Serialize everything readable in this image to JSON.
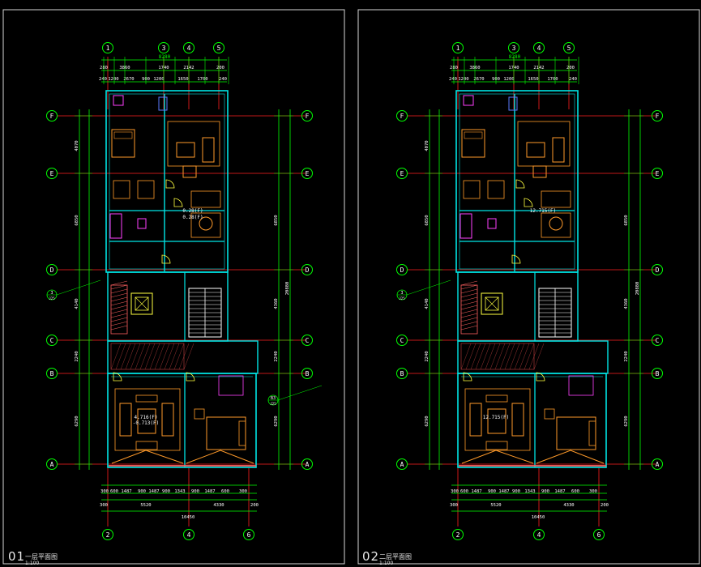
{
  "sheets": [
    {
      "number": "01",
      "title": "一层平面图",
      "scale": "1:100",
      "top_grid_labels": [
        "1",
        "3",
        "4",
        "5"
      ],
      "bottom_grid_labels": [
        "2",
        "4",
        "6"
      ],
      "row_labels": [
        "F",
        "E",
        "D",
        "C",
        "B",
        "A"
      ],
      "top_total": "8280",
      "top_dims_1": [
        "280",
        "3860",
        "1740",
        "2142",
        "200"
      ],
      "top_dims_2": [
        "240",
        "1200",
        "2670",
        "900",
        "1200",
        "1650",
        "1700",
        "240"
      ],
      "bottom_dims_1": [
        "300",
        "600",
        "1487",
        "900",
        "1487",
        "900",
        "1343",
        "900",
        "1487",
        "600",
        "300"
      ],
      "bottom_dims_2": [
        "300",
        "5520",
        "4330",
        "200"
      ],
      "bottom_total": "10450",
      "left_dims_outer": [
        "6850",
        "4140",
        "2240"
      ],
      "left_dims_inner": [
        "4070",
        "6290"
      ],
      "right_dims_outer": [
        "6850",
        "4360",
        "2240",
        "6290"
      ],
      "right_total": "20880",
      "area_labels": [
        "4.716(F)",
        "0.28(F)",
        "-0.713(F)",
        "0.28(F)"
      ],
      "note_labels": [
        "3\nJ25",
        "B3\nJ25"
      ]
    },
    {
      "number": "02",
      "title": "二层平面图",
      "scale": "1:100",
      "top_grid_labels": [
        "1",
        "3",
        "4",
        "5"
      ],
      "bottom_grid_labels": [
        "2",
        "4",
        "6"
      ],
      "row_labels": [
        "F",
        "E",
        "D",
        "C",
        "B",
        "A"
      ],
      "top_total": "8280",
      "top_dims_1": [
        "280",
        "3860",
        "1740",
        "2142",
        "200"
      ],
      "top_dims_2": [
        "240",
        "1200",
        "2670",
        "900",
        "1200",
        "1650",
        "1700",
        "240"
      ],
      "bottom_dims_1": [
        "300",
        "600",
        "1487",
        "900",
        "1487",
        "900",
        "1343",
        "900",
        "1487",
        "600",
        "300"
      ],
      "bottom_dims_2": [
        "300",
        "5520",
        "4330",
        "200"
      ],
      "bottom_total": "10450",
      "left_dims_outer": [
        "6850",
        "4140",
        "2240"
      ],
      "left_dims_inner": [
        "4070",
        "6290"
      ],
      "right_dims_outer": [
        "6850",
        "4360",
        "2240",
        "6290"
      ],
      "right_total": "20880",
      "area_labels": [
        "12.715(F)",
        "12.715(F)"
      ],
      "note_labels": [
        "3\nJ25"
      ]
    }
  ],
  "colors": {
    "background": "#000000",
    "frame": "#d8d8d8",
    "dimension": "#00ff00",
    "axis": "#ff2020",
    "wall": "#00e5e5",
    "furniture": "#ff9a2a",
    "door": "#ffff40",
    "stair": "#ffffff",
    "fixture": "#ff40ff",
    "bubble": "#00ff00",
    "hatch": "#ff6060",
    "blue": "#5c7cff"
  }
}
